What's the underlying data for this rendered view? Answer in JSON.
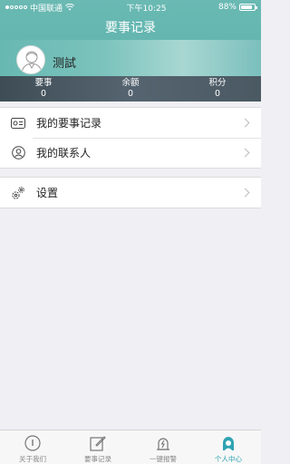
{
  "status_bar": {
    "carrier": "中国联通",
    "time": "下午10:25",
    "battery": "88%",
    "battery_level": 0.88
  },
  "header": {
    "title": "要事记录"
  },
  "profile": {
    "name": "测試"
  },
  "stats": [
    {
      "label": "要事",
      "value": "0"
    },
    {
      "label": "余额",
      "value": "0"
    },
    {
      "label": "积分",
      "value": "0"
    }
  ],
  "menu": {
    "records": "我的要事记录",
    "contacts": "我的联系人",
    "settings": "设置"
  },
  "tabs": [
    {
      "label": "关于我们",
      "icon": "info-icon"
    },
    {
      "label": "要事记录",
      "icon": "edit-icon"
    },
    {
      "label": "一键报警",
      "icon": "alarm-icon"
    },
    {
      "label": "个人中心",
      "icon": "person-icon"
    }
  ],
  "colors": {
    "accent": "#5cb1ac",
    "tab_active": "#2ea3b2"
  }
}
